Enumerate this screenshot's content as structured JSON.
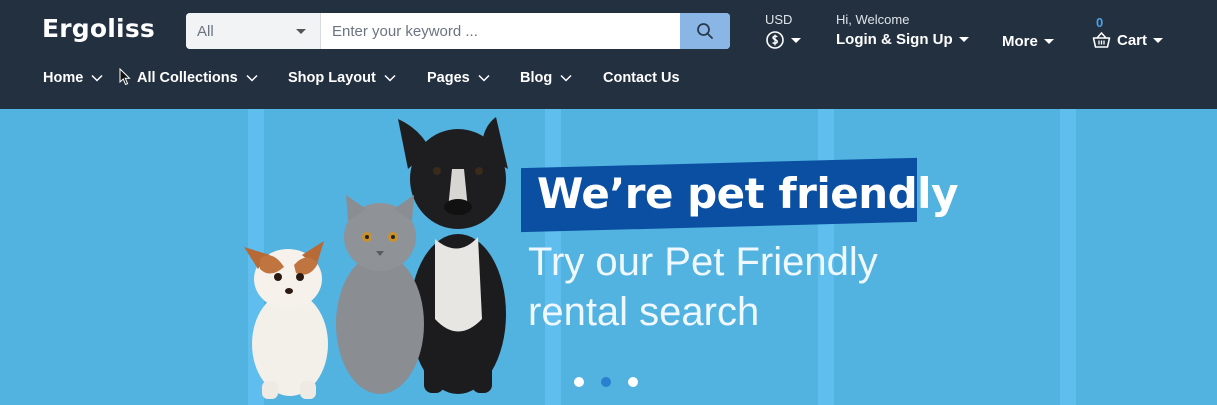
{
  "brand": {
    "name": "Ergoliss"
  },
  "search": {
    "category": "All",
    "placeholder": "Enter your keyword ...",
    "value": ""
  },
  "currency": {
    "label": "USD",
    "icon": "dollar-coin-icon"
  },
  "account": {
    "greeting": "Hi, Welcome",
    "action": "Login & Sign Up"
  },
  "more": {
    "label": "More"
  },
  "cart": {
    "label": "Cart",
    "count": "0",
    "icon": "basket-icon"
  },
  "nav": {
    "items": [
      {
        "label": "Home"
      },
      {
        "label": "All Collections"
      },
      {
        "label": "Shop Layout"
      },
      {
        "label": "Pages"
      },
      {
        "label": "Blog"
      },
      {
        "label": "Contact Us"
      }
    ]
  },
  "banner": {
    "headline": "We’re pet friendly",
    "line1": "Try our Pet Friendly",
    "line2": "rental search",
    "slides_total": 3,
    "active_slide": 2
  },
  "colors": {
    "header_bg": "#233040",
    "banner_bg": "#52b2e0",
    "headline_box": "#0a4fa2",
    "accent": "#4aa3e8",
    "search_button": "#8ab6e6"
  }
}
